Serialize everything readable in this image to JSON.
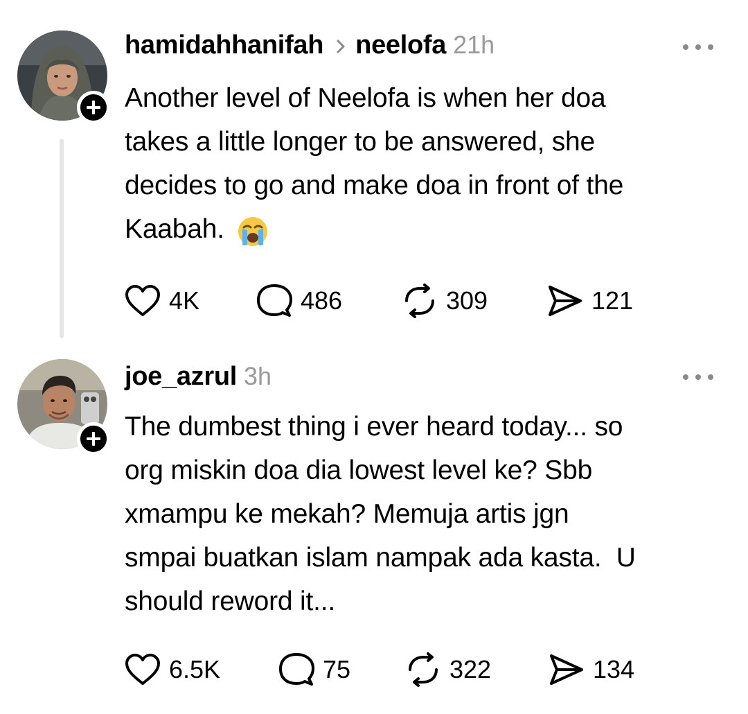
{
  "posts": [
    {
      "username": "hamidahhanifah",
      "reply_to": "neelofa",
      "time": "21h",
      "text": "Another level of Neelofa is when her doa\ntakes a little longer to be answered, she\ndecides to go and make doa in front of the\nKaabah. ",
      "emoji": "crying-face",
      "likes": "4K",
      "replies": "486",
      "reposts": "309",
      "shares": "121",
      "avatar_colors": {
        "bg": "#3a3f44",
        "hijab": "#5b5e55",
        "skin": "#c99a7e"
      }
    },
    {
      "username": "joe_azrul",
      "time": "3h",
      "text": "The dumbest thing i ever heard today... so\norg miskin doa dia lowest level ke? Sbb\nxmampu ke mekah? Memuja artis jgn\nsmpai buatkan islam nampak ada kasta.  U\nshould reword it...",
      "likes": "6.5K",
      "replies": "75",
      "reposts": "322",
      "shares": "134",
      "avatar_colors": {
        "bg": "#8f8a7f",
        "hair": "#2a2320",
        "skin": "#b98466",
        "shirt": "#e8e8e4"
      }
    }
  ],
  "icons": {
    "follow": "plus-icon",
    "more": "more-options-icon",
    "like": "heart-icon",
    "reply": "comment-icon",
    "repost": "repost-icon",
    "share": "send-icon"
  }
}
